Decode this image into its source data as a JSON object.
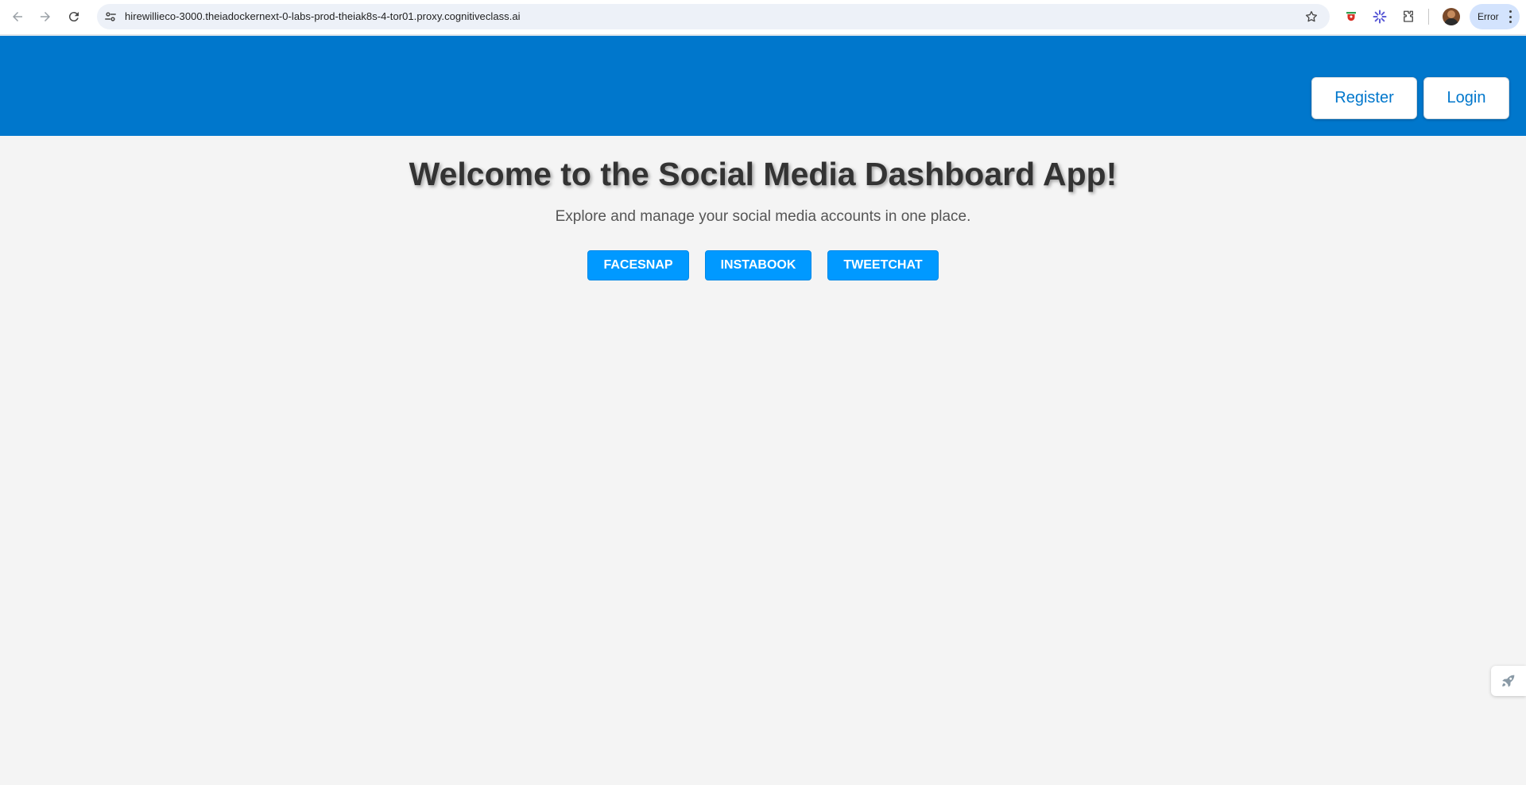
{
  "browser": {
    "url": "hirewillieco-3000.theiadockernext-0-labs-prod-theiak8s-4-tor01.proxy.cognitiveclass.ai",
    "profile_status": "Error",
    "icons": [
      "back-arrow-icon",
      "forward-arrow-icon",
      "reload-icon",
      "site-settings-icon",
      "bookmark-star-icon",
      "shield-extension-icon",
      "sparkle-extension-icon",
      "puzzle-extensions-icon",
      "avatar",
      "kebab-menu-icon"
    ]
  },
  "header": {
    "register_label": "Register",
    "login_label": "Login",
    "background_color": "#0077cc"
  },
  "main": {
    "title": "Welcome to the Social Media Dashboard App!",
    "subtitle": "Explore and manage your social media accounts in one place.",
    "platforms": [
      {
        "label": "FACESNAP"
      },
      {
        "label": "INSTABOOK"
      },
      {
        "label": "TWEETCHAT"
      }
    ],
    "button_color": "#0099ff",
    "background_color": "#f4f4f4"
  },
  "widget": {
    "icon": "rocket-icon"
  }
}
